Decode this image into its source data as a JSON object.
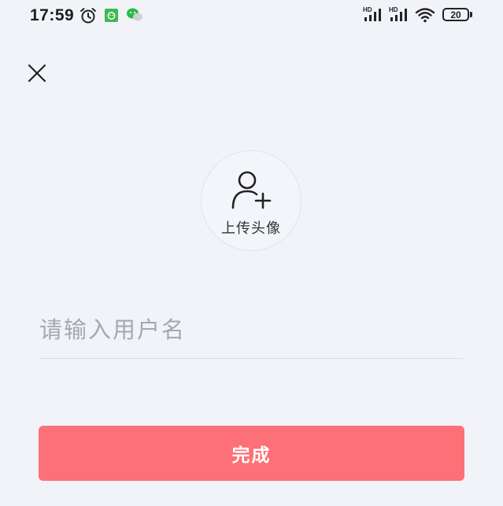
{
  "status_bar": {
    "time": "17:59",
    "battery_level": "20",
    "signal_1_label": "HD",
    "signal_2_label": "HD",
    "icons": [
      "alarm-icon",
      "app-notification-icon",
      "wechat-icon",
      "hd-signal-icon",
      "hd-signal-icon",
      "wifi-icon",
      "battery-icon"
    ]
  },
  "header": {
    "close_icon": "close-icon"
  },
  "avatar": {
    "label": "上传头像",
    "icon": "add-user-icon"
  },
  "form": {
    "username_value": "",
    "username_placeholder": "请输入用户名"
  },
  "actions": {
    "done_label": "完成"
  },
  "colors": {
    "background": "#f1f3f9",
    "primary_button": "#fe7077",
    "placeholder_text": "#a6a8ae",
    "app_icon_green": "#3fb950",
    "wechat_green": "#2ab94a"
  }
}
